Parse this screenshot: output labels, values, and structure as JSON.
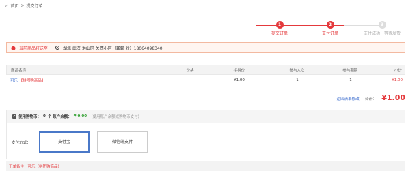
{
  "breadcrumb": {
    "home": "首页",
    "sep": ">",
    "current": "提交订单"
  },
  "steps": [
    {
      "num": "1",
      "label": "提交订单"
    },
    {
      "num": "2",
      "label": "支付订单"
    },
    {
      "num": "3",
      "label": "支付成功，等待发货"
    }
  ],
  "address": {
    "label": "当前商品将送至：",
    "value": "湖北 武汉 洪山区 关西小区（龚翰 收）18064098340"
  },
  "table": {
    "headers": [
      "商品名称",
      "价格",
      "拼拼价",
      "参与人次",
      "参与期期",
      "小计"
    ],
    "rows": [
      {
        "name": "可乐",
        "tag": "【拼团购商品】",
        "price": "--",
        "tuan": "¥1.00",
        "times": "1",
        "period": "1",
        "subtotal": "¥1.00"
      }
    ]
  },
  "summary": {
    "back_link": "返回清单修改",
    "total_label": "合计：",
    "total_value": "¥1.00"
  },
  "coin": {
    "check": "✔",
    "label_a": "使用购物币：",
    "coin_count": "0",
    "label_b": "个 账户余额：",
    "balance": "¥ 0.00",
    "hint": "（使用账户余额或购物币支付）"
  },
  "payment": {
    "label": "支付方式：",
    "alipay": "支付宝",
    "wechat": "微信端支付"
  },
  "remark": "下单备注：可乐（拼团购商品）",
  "colors": {
    "accent": "#e4393c",
    "link": "#3366cc",
    "selected_border": "#4a78c8"
  }
}
